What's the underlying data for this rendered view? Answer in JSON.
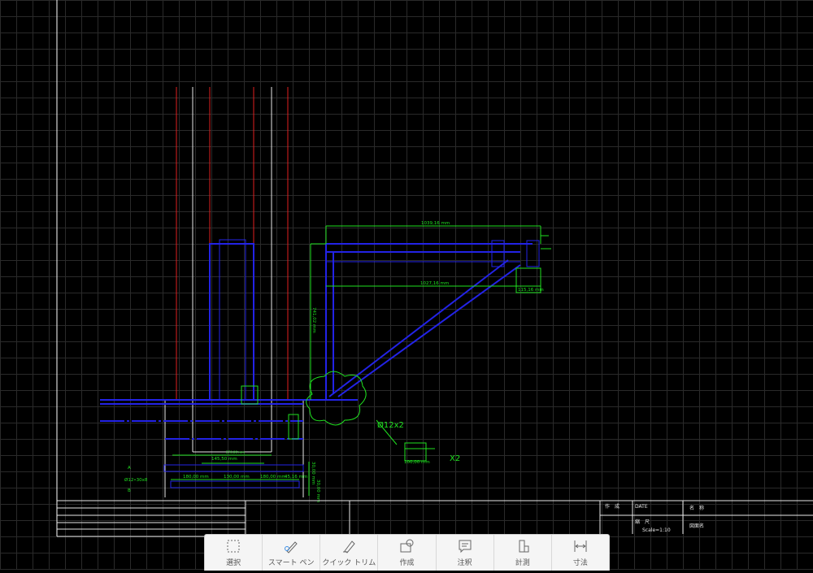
{
  "drawing": {
    "dims": {
      "top": "1039,16 mm",
      "inner": "1027,16 mm",
      "right_small": "115,16 mm",
      "vertical": "741,02 mm",
      "left_small": "270,00 mm",
      "bottom1": "145,50 mm",
      "bottom2": "180,00 mm",
      "bottom3": "130,00 mm",
      "bottom4": "180,00 mm",
      "bottom5": "45,16 mm",
      "detail_bottom": "100,00 mm",
      "vert_right1": "30,00 mm",
      "vert_right2": "30,00 mm"
    },
    "labels": {
      "rebar": "Ø12x2",
      "x2": "X2",
      "a": "A",
      "b": "B",
      "rebar_spec": "Ø12•30x8"
    }
  },
  "title_block": {
    "author_label": "作　成",
    "date_label": "DATE",
    "name_label": "名　称",
    "scale_label": "縮　尺",
    "scale_value": "Scale=1:10",
    "drawing_name_label": "図面名"
  },
  "toolbar": {
    "items": [
      {
        "label": "選択",
        "icon": "select-icon"
      },
      {
        "label": "スマート ペン",
        "icon": "smart-pen-icon"
      },
      {
        "label": "クイック トリム",
        "icon": "quick-trim-icon"
      },
      {
        "label": "作成",
        "icon": "create-icon"
      },
      {
        "label": "注釈",
        "icon": "annotation-icon"
      },
      {
        "label": "計測",
        "icon": "measure-icon"
      },
      {
        "label": "寸法",
        "icon": "dimension-icon"
      }
    ]
  },
  "colors": {
    "background": "#000000",
    "grid": "#2a2a2a",
    "structure": "#2020e0",
    "dimension": "#20e020",
    "column": "#ff2020",
    "outline": "#ffffff",
    "toolbar_bg": "#f5f5f5"
  }
}
